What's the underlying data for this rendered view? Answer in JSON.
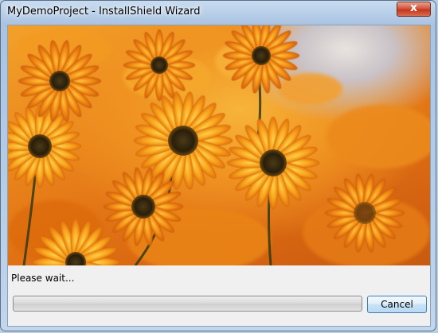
{
  "window": {
    "title": "MyDemoProject - InstallShield Wizard",
    "close_glyph": "x"
  },
  "main": {
    "status_text": "Please wait...",
    "progress_fraction": 0.0
  },
  "buttons": {
    "cancel_label": "Cancel"
  },
  "colors": {
    "title_bar": "#b5cde8",
    "close_button": "#cf4a32",
    "dialog_background": "#f0f0f0",
    "flower_orange": "#f28a1a",
    "flower_center": "#3a2a10"
  },
  "icons": {
    "close": "close-icon"
  }
}
